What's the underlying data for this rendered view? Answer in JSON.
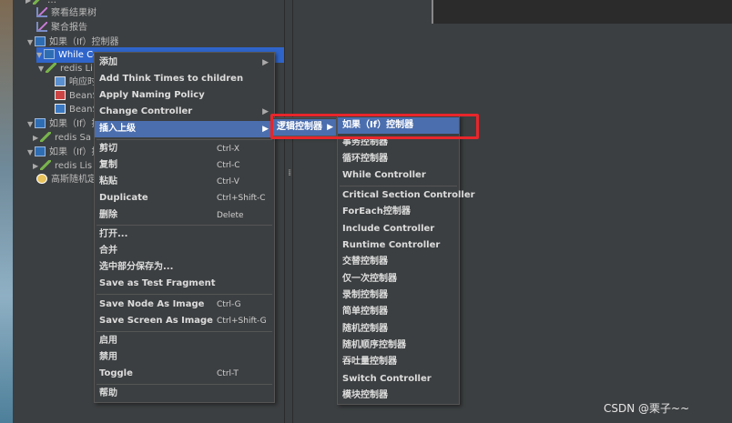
{
  "tree": {
    "nodes": [
      {
        "label": "察看结果树"
      },
      {
        "label": "聚合报告"
      },
      {
        "label": "如果（If）控制器"
      },
      {
        "label": "While Co"
      },
      {
        "label": "redis Li"
      },
      {
        "label": "响应时"
      },
      {
        "label": "BeanS"
      },
      {
        "label": "BeanS"
      },
      {
        "label": "如果（If）控"
      },
      {
        "label": "redis Sa"
      },
      {
        "label": "如果（If）控"
      },
      {
        "label": "redis Lis"
      },
      {
        "label": "高斯随机定"
      }
    ]
  },
  "context_menu": {
    "items": [
      {
        "label": "添加",
        "submenu": true
      },
      {
        "label": "Add Think Times to children"
      },
      {
        "label": "Apply Naming Policy"
      },
      {
        "label": "Change Controller",
        "submenu": true
      },
      {
        "label": "插入上级",
        "submenu": true,
        "highlighted": true
      },
      {
        "label": "剪切",
        "shortcut": "Ctrl-X"
      },
      {
        "label": "复制",
        "shortcut": "Ctrl-C"
      },
      {
        "label": "粘贴",
        "shortcut": "Ctrl-V"
      },
      {
        "label": "Duplicate",
        "shortcut": "Ctrl+Shift-C"
      },
      {
        "label": "删除",
        "shortcut": "Delete"
      },
      {
        "label": "打开..."
      },
      {
        "label": "合并"
      },
      {
        "label": "选中部分保存为..."
      },
      {
        "label": "Save as Test Fragment"
      },
      {
        "label": "Save Node As Image",
        "shortcut": "Ctrl-G"
      },
      {
        "label": "Save Screen As Image",
        "shortcut": "Ctrl+Shift-G"
      },
      {
        "label": "启用"
      },
      {
        "label": "禁用"
      },
      {
        "label": "Toggle",
        "shortcut": "Ctrl-T"
      },
      {
        "label": "帮助"
      }
    ]
  },
  "logic_menu": {
    "label": "逻辑控制器"
  },
  "controller_menu": {
    "items": [
      {
        "label": "如果（If）控制器"
      },
      {
        "label": "事务控制器"
      },
      {
        "label": "循环控制器"
      },
      {
        "label": "While Controller"
      },
      {
        "label": "Critical Section Controller"
      },
      {
        "label": "ForEach控制器"
      },
      {
        "label": "Include Controller"
      },
      {
        "label": "Runtime Controller"
      },
      {
        "label": "交替控制器"
      },
      {
        "label": "仅一次控制器"
      },
      {
        "label": "录制控制器"
      },
      {
        "label": "简单控制器"
      },
      {
        "label": "随机控制器"
      },
      {
        "label": "随机顺序控制器"
      },
      {
        "label": "吞吐量控制器"
      },
      {
        "label": "Switch Controller"
      },
      {
        "label": "模块控制器"
      }
    ]
  },
  "watermark": "CSDN @栗子~~"
}
